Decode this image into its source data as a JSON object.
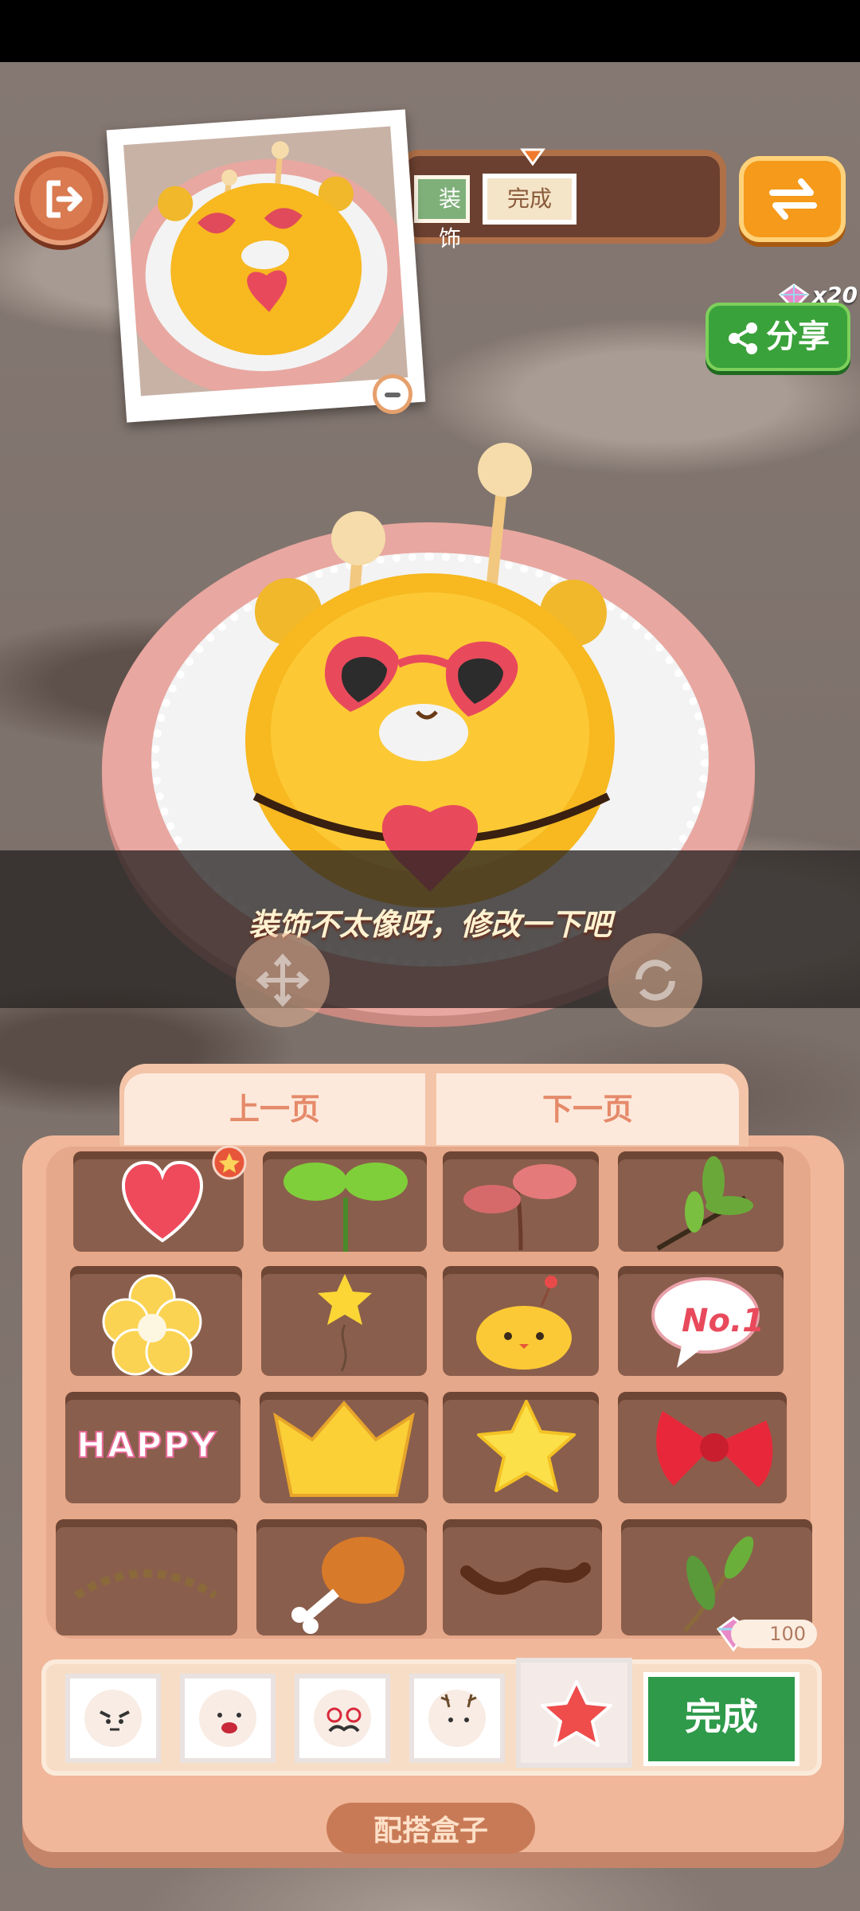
{
  "steps": {
    "decorate_label": "装饰",
    "done_label": "完成"
  },
  "share": {
    "label": "分享",
    "gem_count": "x20"
  },
  "toast": {
    "message": "装饰不太像呀，修改一下吧"
  },
  "box": {
    "prev_page": "上一页",
    "next_page": "下一页",
    "title": "配搭盒子",
    "items": [
      {
        "name": "heart-icon"
      },
      {
        "name": "sprout-icon"
      },
      {
        "name": "red-sprout-icon"
      },
      {
        "name": "branch-icon"
      },
      {
        "name": "flower-icon"
      },
      {
        "name": "star-balloon-icon"
      },
      {
        "name": "chick-icon"
      },
      {
        "name": "no1-bubble-icon"
      },
      {
        "name": "happy-text-sticker",
        "text": "HAPPY"
      },
      {
        "name": "crown-icon"
      },
      {
        "name": "star-icon"
      },
      {
        "name": "bow-icon"
      },
      {
        "name": "eyelash-icon"
      },
      {
        "name": "drumstick-icon"
      },
      {
        "name": "chocolate-squiggle-icon"
      },
      {
        "name": "leaf-sprig-icon"
      }
    ],
    "locked_price": "100",
    "no1_text": "No.1",
    "done_button": "完成"
  },
  "colors": {
    "accent_orange": "#f59a1a",
    "share_green": "#3aa23a",
    "done_green": "#2e9a4a"
  }
}
